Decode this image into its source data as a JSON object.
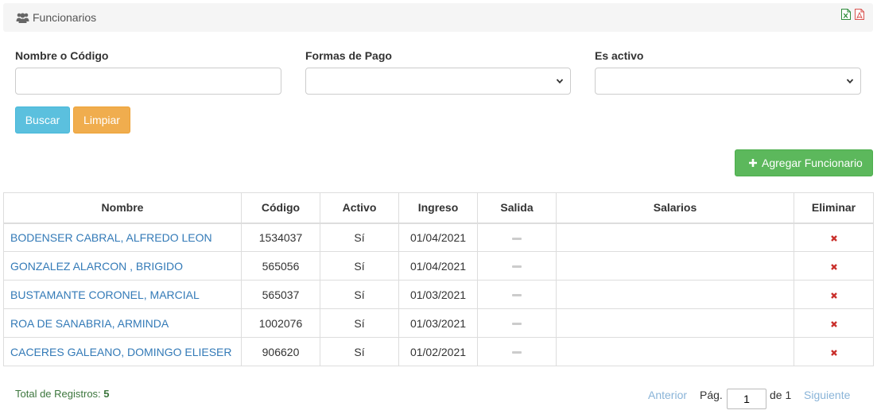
{
  "header": {
    "title": "Funcionarios",
    "icons": {
      "title": "users-icon",
      "export_excel": "excel-file-icon",
      "export_pdf": "pdf-file-icon"
    }
  },
  "filters": {
    "name_label": "Nombre o Código",
    "name_value": "",
    "payment_label": "Formas de Pago",
    "payment_value": "",
    "active_label": "Es activo",
    "active_value": ""
  },
  "buttons": {
    "search": "Buscar",
    "clear": "Limpiar",
    "add": "Agregar Funcionario"
  },
  "table": {
    "headers": [
      "Nombre",
      "Código",
      "Activo",
      "Ingreso",
      "Salida",
      "Salarios",
      "Eliminar"
    ],
    "rows": [
      {
        "nombre": "BODENSER CABRAL, ALFREDO LEON",
        "codigo": "1534037",
        "activo": "Sí",
        "ingreso": "01/04/2021"
      },
      {
        "nombre": "GONZALEZ ALARCON , BRIGIDO",
        "codigo": "565056",
        "activo": "Sí",
        "ingreso": "01/04/2021"
      },
      {
        "nombre": "BUSTAMANTE CORONEL, MARCIAL",
        "codigo": "565037",
        "activo": "Sí",
        "ingreso": "01/03/2021"
      },
      {
        "nombre": "ROA DE SANABRIA, ARMINDA",
        "codigo": "1002076",
        "activo": "Sí",
        "ingreso": "01/03/2021"
      },
      {
        "nombre": "CACERES GALEANO, DOMINGO ELIESER",
        "codigo": "906620",
        "activo": "Sí",
        "ingreso": "01/02/2021"
      }
    ]
  },
  "footer": {
    "total_label": "Total de Registros:",
    "total_value": "5",
    "prev": "Anterior",
    "page_label": "Pág.",
    "page_value": "1",
    "of_label": "de 1",
    "next": "Siguiente"
  },
  "colors": {
    "link": "#337ab7",
    "search_button": "#5bc0de",
    "clear_button": "#f0ad4e",
    "add_button": "#5cb85c",
    "delete_icon": "#c9302c"
  }
}
